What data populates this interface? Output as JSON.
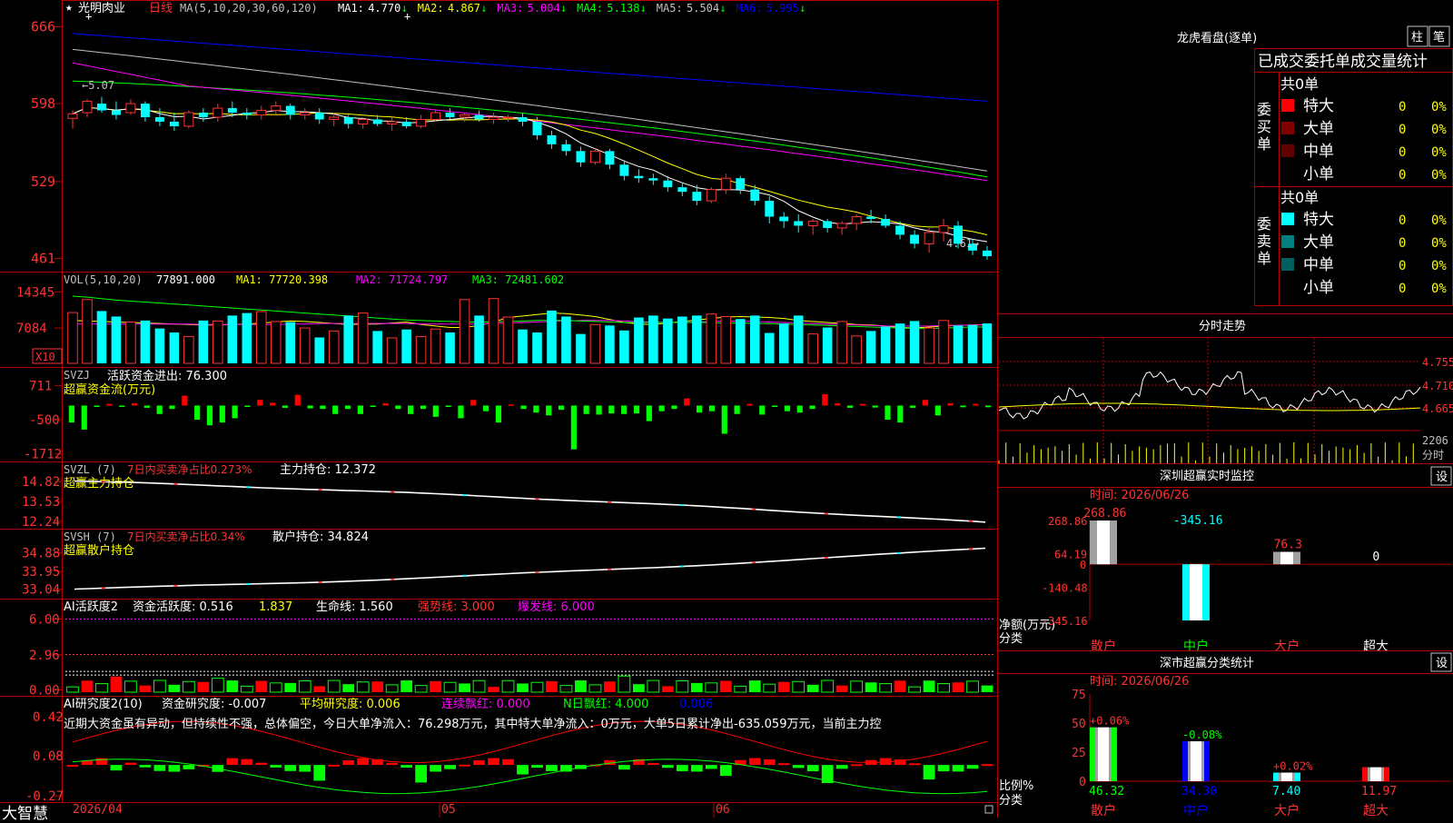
{
  "colors": {
    "up": "#ff3232",
    "down": "#00ffff",
    "grid": "#b40000",
    "axis_text": "#ff3232",
    "label": "#c0c0c0",
    "ma1": "#ffffff",
    "ma2": "#ffff00",
    "ma3": "#ff00ff",
    "ma4": "#00ff00",
    "ma5": "#c0c0c0",
    "ma6": "#0000ff",
    "green": "#00ff00",
    "yellow": "#ffff00",
    "magenta": "#ff00ff",
    "white": "#ffffff"
  },
  "header": {
    "stock_name": "光明肉业",
    "period": "日线",
    "ma_title": "MA(5,10,20,30,60,120)",
    "ma_items": [
      {
        "label": "MA1:",
        "value": "4.770",
        "arrow": "↓"
      },
      {
        "label": "MA2:",
        "value": "4.867",
        "arrow": "↓"
      },
      {
        "label": "MA3:",
        "value": "5.004",
        "arrow": "↓"
      },
      {
        "label": "MA4:",
        "value": "5.138",
        "arrow": "↓"
      },
      {
        "label": "MA5:",
        "value": "5.504",
        "arrow": "↓"
      },
      {
        "label": "MA6:",
        "value": "5.995",
        "arrow": "↓"
      }
    ]
  },
  "annotations": {
    "high_marker": "←5.07",
    "low_marker": "4.61→"
  },
  "vol_header": {
    "title": "VOL(5,10,20)",
    "value": "77891.000",
    "ma1": "MA1: 77720.398",
    "ma2": "MA2: 71724.797",
    "ma3": "MA3: 72481.602",
    "unit": "X10"
  },
  "svzj_header": {
    "title": "SVZJ",
    "text": "活跃资金进出: 76.300",
    "sub": "超赢资金流(万元)"
  },
  "svzl_header": {
    "title": "SVZL (7)",
    "text1": "7日内买卖净占比0.273%",
    "text2": "主力持仓: 12.372",
    "sub": "超赢主力持仓"
  },
  "svsh_header": {
    "title": "SVSH (7)",
    "text1": "7日内买卖净占比0.34%",
    "text2": "散户持仓: 34.824",
    "sub": "超赢散户持仓"
  },
  "ai_act_header": {
    "title": "AI活跃度2",
    "t1": "资金活跃度: 0.516",
    "t2": "1.837",
    "t3": "生命线: 1.560",
    "t4": "强势线: 3.000",
    "t5": "爆发线: 6.000"
  },
  "ai_res_header": {
    "title": "AI研究度2(10)",
    "t1": "资金研究度: -0.007",
    "t2": "平均研究度: 0.006",
    "t3": "连续飘红: 0.000",
    "t4": "N日飘红: 4.000",
    "t5": "0.006"
  },
  "note": "近期大资金虽有异动，但持续性不强，总体偏空，今日大单净流入：76.298万元，其中特大单净流入：0万元，大单5日累计净出-635.059万元，当前主力控",
  "bottom": {
    "brand": "大智慧",
    "date": "2026/04",
    "m05": "05",
    "m06": "06"
  },
  "right": {
    "lhb_title": "龙虎看盘(逐单)",
    "btn_zhu": "柱",
    "btn_bi": "笔",
    "stats_title": "已成交委托单成交量统计",
    "buy_label": [
      "委",
      "买",
      "单"
    ],
    "sell_label": [
      "委",
      "卖",
      "单"
    ],
    "buy_total": "共0单",
    "sell_total": "共0单",
    "buy_rows": [
      {
        "name": "特大",
        "count": "0",
        "pct": "0%",
        "color": "#ff0000"
      },
      {
        "name": "大单",
        "count": "0",
        "pct": "0%",
        "color": "#800000"
      },
      {
        "name": "中单",
        "count": "0",
        "pct": "0%",
        "color": "#600000"
      },
      {
        "name": "小单",
        "count": "0",
        "pct": "0%",
        "color": "#000000"
      }
    ],
    "sell_rows": [
      {
        "name": "特大",
        "count": "0",
        "pct": "0%",
        "color": "#00ffff"
      },
      {
        "name": "大单",
        "count": "0",
        "pct": "0%",
        "color": "#008080"
      },
      {
        "name": "中单",
        "count": "0",
        "pct": "0%",
        "color": "#006060"
      },
      {
        "name": "小单",
        "count": "0",
        "pct": "0%",
        "color": "#000000"
      }
    ],
    "intraday_title": "分时走势",
    "intraday_prices": [
      "4.755",
      "4.710",
      "4.665"
    ],
    "intraday_vol": "2206",
    "intraday_vol_unit": "分时",
    "monitor_title": "深圳超赢实时监控",
    "set": "设",
    "monitor_time": "时间: 2026/06/26",
    "monitor_ylabels": [
      "268.86",
      "64.19",
      "0",
      "-140.48",
      "-345.16"
    ],
    "monitor_axis_label": "净额(万元)",
    "monitor_axis_label2": "分类",
    "stat_title": "深市超赢分类统计",
    "stat_time": "时间: 2026/06/26",
    "stat_ylabels": [
      "75",
      "50",
      "25",
      "0"
    ],
    "stat_axis_label": "比例%",
    "stat_axis_label2": "分类"
  },
  "chart_data": [
    {
      "type": "candlestick",
      "name": "price",
      "y_ticks": [
        666,
        598,
        529,
        461
      ],
      "ylim": [
        455,
        672
      ],
      "candles": [
        [
          585,
          592,
          576,
          589
        ],
        [
          590,
          602,
          586,
          600
        ],
        [
          598,
          604,
          590,
          592
        ],
        [
          592,
          600,
          584,
          588
        ],
        [
          590,
          602,
          588,
          598
        ],
        [
          598,
          600,
          582,
          586
        ],
        [
          586,
          594,
          578,
          582
        ],
        [
          582,
          590,
          574,
          578
        ],
        [
          578,
          592,
          576,
          590
        ],
        [
          590,
          594,
          582,
          586
        ],
        [
          586,
          598,
          582,
          594
        ],
        [
          594,
          600,
          586,
          590
        ],
        [
          590,
          594,
          584,
          588
        ],
        [
          588,
          596,
          584,
          592
        ],
        [
          592,
          600,
          588,
          596
        ],
        [
          596,
          598,
          584,
          588
        ],
        [
          588,
          594,
          584,
          590
        ],
        [
          590,
          594,
          580,
          584
        ],
        [
          584,
          590,
          578,
          586
        ],
        [
          586,
          588,
          576,
          580
        ],
        [
          580,
          586,
          576,
          584
        ],
        [
          584,
          588,
          578,
          580
        ],
        [
          580,
          586,
          574,
          582
        ],
        [
          582,
          586,
          576,
          578
        ],
        [
          578,
          588,
          576,
          584
        ],
        [
          584,
          592,
          582,
          590
        ],
        [
          590,
          594,
          584,
          586
        ],
        [
          586,
          590,
          582,
          588
        ],
        [
          588,
          592,
          582,
          584
        ],
        [
          584,
          590,
          580,
          586
        ],
        [
          586,
          588,
          582,
          586
        ],
        [
          586,
          590,
          578,
          582
        ],
        [
          582,
          586,
          566,
          570
        ],
        [
          570,
          574,
          558,
          562
        ],
        [
          562,
          566,
          552,
          556
        ],
        [
          556,
          560,
          542,
          546
        ],
        [
          546,
          558,
          544,
          556
        ],
        [
          556,
          558,
          540,
          544
        ],
        [
          544,
          548,
          530,
          534
        ],
        [
          534,
          540,
          528,
          532
        ],
        [
          532,
          536,
          526,
          530
        ],
        [
          530,
          534,
          520,
          524
        ],
        [
          524,
          528,
          516,
          520
        ],
        [
          520,
          526,
          508,
          512
        ],
        [
          512,
          524,
          510,
          522
        ],
        [
          522,
          536,
          518,
          532
        ],
        [
          532,
          534,
          518,
          522
        ],
        [
          522,
          526,
          508,
          512
        ],
        [
          512,
          516,
          492,
          498
        ],
        [
          498,
          502,
          488,
          494
        ],
        [
          494,
          500,
          484,
          490
        ],
        [
          490,
          496,
          482,
          494
        ],
        [
          494,
          496,
          484,
          488
        ],
        [
          488,
          494,
          482,
          492
        ],
        [
          492,
          500,
          486,
          498
        ],
        [
          498,
          504,
          492,
          496
        ],
        [
          496,
          500,
          488,
          490
        ],
        [
          490,
          494,
          478,
          482
        ],
        [
          482,
          486,
          470,
          474
        ],
        [
          474,
          488,
          466,
          484
        ],
        [
          484,
          496,
          476,
          490
        ],
        [
          490,
          494,
          470,
          474
        ],
        [
          474,
          478,
          464,
          468
        ],
        [
          468,
          472,
          460,
          463
        ]
      ]
    },
    {
      "type": "bar",
      "name": "volume",
      "y_ticks": [
        14345,
        7084
      ],
      "ylim": [
        0,
        15500
      ],
      "values": [
        10200,
        12800,
        10500,
        9400,
        8300,
        8600,
        7000,
        6200,
        5400,
        8600,
        8500,
        9600,
        10100,
        10400,
        8400,
        8300,
        7100,
        5200,
        6500,
        9600,
        10100,
        6500,
        5100,
        6800,
        5400,
        6900,
        6200,
        12800,
        9600,
        13000,
        9300,
        6800,
        6200,
        10600,
        9400,
        5900,
        7800,
        7600,
        6600,
        9200,
        9600,
        9000,
        9400,
        9600,
        9900,
        9400,
        8900,
        9600,
        6100,
        8000,
        9600,
        5900,
        7200,
        8400,
        5500,
        6500,
        7400,
        8000,
        8500,
        7100,
        8600,
        7600,
        7700,
        8000
      ],
      "ma": [
        [
          8600,
          8500,
          8400,
          8300,
          8200,
          8100,
          8000,
          7900,
          7800,
          7700,
          7700,
          7800,
          7900,
          8100,
          8300,
          8500,
          8400,
          8200,
          8000,
          7800,
          7900,
          7900,
          8100,
          8300,
          7800,
          7500,
          7200,
          7200,
          7600,
          8300,
          9200,
          9500,
          9800,
          10100,
          10000,
          9700,
          9400,
          8800,
          8200,
          7900,
          7800,
          8100,
          8400,
          8700,
          9000,
          9300,
          9400,
          9300,
          9200,
          9000,
          8600,
          8400,
          8200,
          8000,
          7800,
          7700,
          7500,
          7200,
          7100,
          7300,
          7500,
          7600,
          7700,
          7800
        ],
        [
          7900,
          7900,
          7900,
          7900,
          7900,
          7900,
          7900,
          7900,
          7900,
          7800,
          7800,
          7800,
          7800,
          7800,
          7800,
          7900,
          7900,
          8000,
          8000,
          8000,
          8000,
          8000,
          8000,
          8000,
          7900,
          7900,
          7900,
          7900,
          7900,
          8000,
          8100,
          8200,
          8300,
          8400,
          8500,
          8600,
          8600,
          8600,
          8500,
          8400,
          8300,
          8200,
          8200,
          8300,
          8400,
          8500,
          8500,
          8400,
          8300,
          8200,
          8100,
          8000,
          7900,
          7800,
          7700,
          7600,
          7500,
          7500,
          7500,
          7500,
          7600,
          7600,
          7700,
          7700
        ],
        [
          13500,
          13300,
          13000,
          12700,
          12500,
          12300,
          12100,
          11900,
          11700,
          11500,
          11300,
          11100,
          10900,
          10700,
          10500,
          10300,
          10100,
          9900,
          9700,
          9500,
          9300,
          9100,
          8900,
          8700,
          8600,
          8500,
          8400,
          8300,
          8300,
          8300,
          8400,
          8500,
          8600,
          8600,
          8600,
          8500,
          8400,
          8300,
          8200,
          8200,
          8200,
          8200,
          8200,
          8200,
          8200,
          8100,
          8100,
          8000,
          8000,
          7900,
          7800,
          7700,
          7600,
          7500,
          7400,
          7300,
          7200,
          7100,
          7000,
          7000,
          7100,
          7200,
          7300,
          7300
        ]
      ]
    },
    {
      "type": "bar",
      "name": "svzj",
      "y_ticks": [
        711,
        -500,
        -1712
      ],
      "ylim": [
        -1850,
        850
      ],
      "values": [
        -600,
        -850,
        -50,
        60,
        -20,
        80,
        -80,
        -300,
        -120,
        350,
        -500,
        -700,
        -600,
        -450,
        -50,
        200,
        100,
        -80,
        380,
        -100,
        -120,
        -300,
        -120,
        -300,
        -50,
        80,
        -120,
        -300,
        -120,
        -400,
        -50,
        -450,
        200,
        -200,
        -600,
        40,
        -120,
        -250,
        -350,
        -150,
        -1550,
        -300,
        -320,
        -280,
        -300,
        -280,
        -550,
        -200,
        -120,
        250,
        -250,
        -200,
        -1000,
        -300,
        60,
        -320,
        -50,
        -200,
        -250,
        -120,
        400,
        80,
        -80,
        60,
        -70,
        -500,
        -600,
        -80,
        200,
        -350,
        80,
        -60,
        60,
        -60
      ]
    },
    {
      "type": "line",
      "name": "svzl",
      "y_ticks": [
        14.82,
        13.53,
        12.24
      ],
      "ylim": [
        12.0,
        15.3
      ]
    },
    {
      "type": "line",
      "name": "svsh",
      "y_ticks": [
        34.88,
        33.95,
        33.04
      ],
      "ylim": [
        32.8,
        35.4
      ]
    },
    {
      "type": "bar",
      "name": "ai_activity",
      "y_ticks": [
        6.0,
        2.96,
        0.0
      ],
      "ylim": [
        -0.2,
        6.5
      ],
      "lines": [
        6.0,
        3.0,
        1.56
      ]
    },
    {
      "type": "bar",
      "name": "ai_research",
      "y_ticks": [
        0.42,
        0.08,
        -0.27
      ],
      "ylim": [
        -0.3,
        0.46
      ]
    },
    {
      "type": "bar",
      "name": "monitor",
      "categories": [
        "散户",
        "中户",
        "大户",
        "超大"
      ],
      "values": [
        268.86,
        -345.16,
        76.3,
        0
      ],
      "labels": [
        "268.86",
        "-345.16",
        "76.3",
        "0"
      ],
      "ylim": [
        -345.16,
        268.86
      ]
    },
    {
      "type": "bar",
      "name": "stat",
      "categories": [
        "散户",
        "中户",
        "大户",
        "超大"
      ],
      "values": [
        46.32,
        34.3,
        7.4,
        11.97
      ],
      "labels": [
        "46.32",
        "34.30",
        "7.40",
        "11.97"
      ],
      "changes": [
        "+0.06%",
        "-0.08%",
        "+0.02%",
        ""
      ],
      "ylim": [
        0,
        75
      ]
    }
  ]
}
